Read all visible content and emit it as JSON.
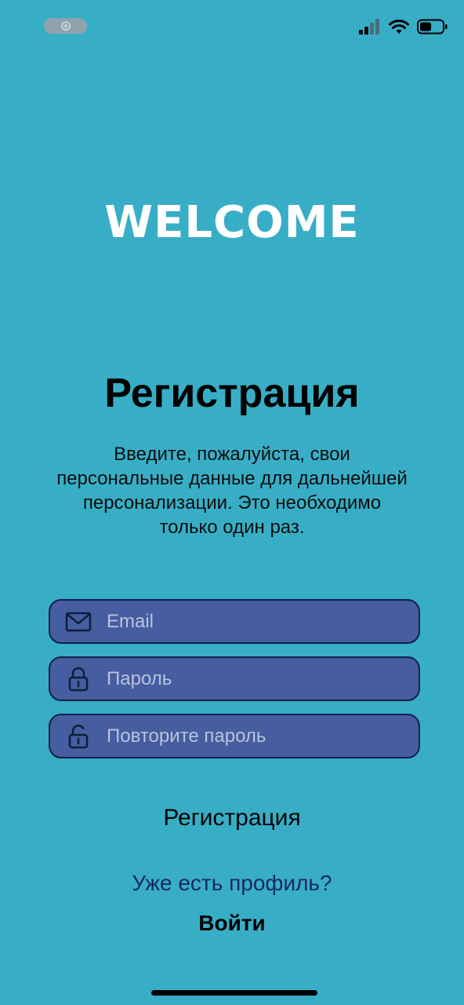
{
  "status_bar": {
    "icons": [
      "screen-recording-icon",
      "signal-icon",
      "wifi-icon",
      "battery-icon"
    ]
  },
  "header": {
    "logo_text": "WELCOME"
  },
  "main": {
    "title": "Регистрация",
    "description": "Введите, пожалуйста, свои персональные данные для дальнейшей персонализации. Это необходимо только один раз."
  },
  "form": {
    "email": {
      "placeholder": "Email",
      "value": "",
      "icon": "envelope-icon"
    },
    "password": {
      "placeholder": "Пароль",
      "value": "",
      "icon": "lock-icon"
    },
    "repeat_password": {
      "placeholder": "Повторите пароль",
      "value": "",
      "icon": "unlock-icon"
    },
    "submit_label": "Регистрация"
  },
  "footer": {
    "have_profile_text": "Уже есть профиль?",
    "login_label": "Войти"
  },
  "colors": {
    "background": "#38aec6",
    "field_fill": "#465d9f",
    "field_border": "#10204a",
    "link_text": "#162a5e"
  }
}
